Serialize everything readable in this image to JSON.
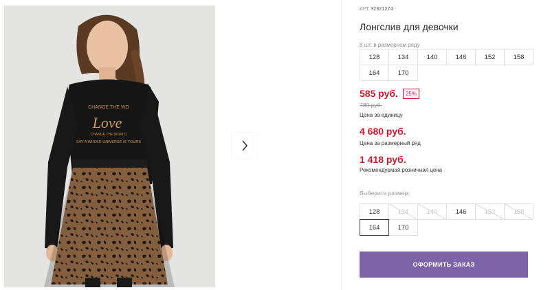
{
  "product": {
    "art_label": "АРТ",
    "art_value": "32321274",
    "title": "Лонгслив для девочки"
  },
  "gallery": {
    "next_icon": "chevron-right-icon",
    "print_lines": [
      "CHANGE THE WO",
      "Love",
      "CHANGE THE WORLD",
      "SAY A WHOLE UNIVERSE IS YOURS"
    ]
  },
  "pack": {
    "label": "8 шт. в размерном ряду",
    "sizes": [
      "128",
      "134",
      "140",
      "146",
      "152",
      "158",
      "164",
      "170"
    ]
  },
  "prices": {
    "unit_price": "585 руб.",
    "discount": "25%",
    "old_price": "780 руб.",
    "unit_note": "Цена за единицу",
    "pack_price": "4 680 руб.",
    "pack_note": "Цена за размерный ряд",
    "rrp_price": "1 418 руб.",
    "rrp_note": "Рекомендуемая розничная цена"
  },
  "size_select": {
    "label": "Выберите размер:",
    "sizes": [
      {
        "label": "128",
        "available": true,
        "selected": false
      },
      {
        "label": "134",
        "available": false,
        "selected": false
      },
      {
        "label": "140",
        "available": false,
        "selected": false
      },
      {
        "label": "146",
        "available": true,
        "selected": false
      },
      {
        "label": "152",
        "available": false,
        "selected": false
      },
      {
        "label": "158",
        "available": false,
        "selected": false
      },
      {
        "label": "164",
        "available": true,
        "selected": true
      },
      {
        "label": "170",
        "available": true,
        "selected": false
      }
    ]
  },
  "order_button": {
    "label": "ОФОРМИТЬ ЗАКАЗ",
    "color": "#7d64a8"
  },
  "colors": {
    "price_red": "#d5172b",
    "accent_purple": "#7d64a8"
  }
}
